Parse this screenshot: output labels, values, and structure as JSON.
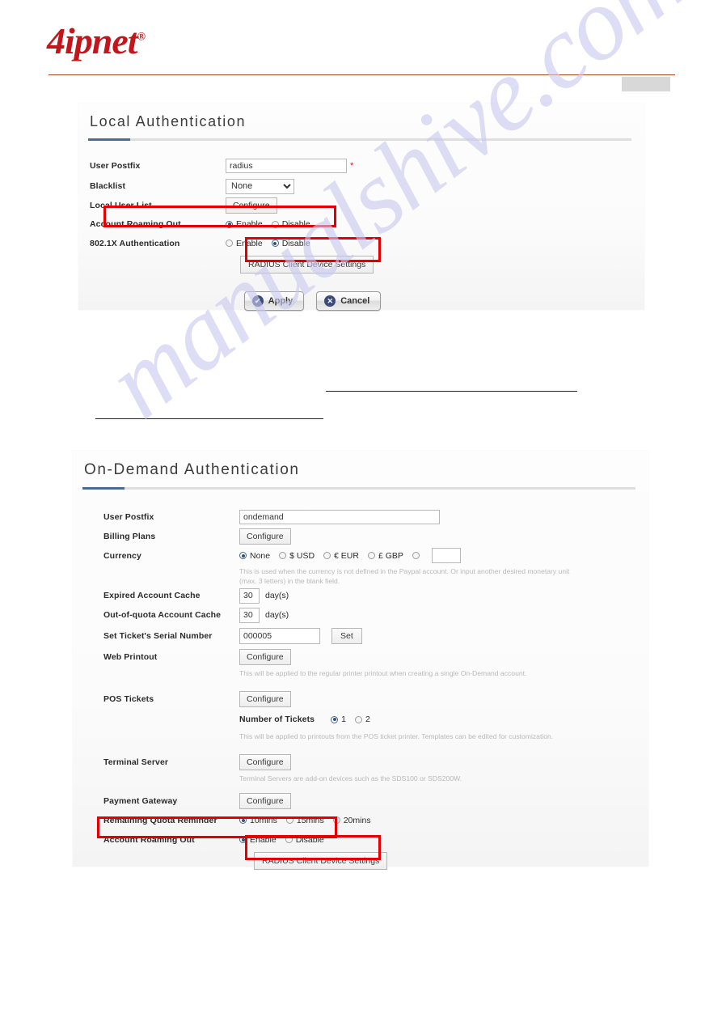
{
  "brand": {
    "name": "4ipnet",
    "reg": "®"
  },
  "local_auth": {
    "title": "Local Authentication",
    "rows": {
      "user_postfix": {
        "label": "User Postfix",
        "value": "radius",
        "required_mark": "*"
      },
      "blacklist": {
        "label": "Blacklist",
        "value": "None",
        "options": [
          "None"
        ]
      },
      "local_user_list": {
        "label": "Local User List",
        "button": "Configure"
      },
      "account_roaming_out": {
        "label": "Account Roaming Out",
        "options": [
          {
            "label": "Enable",
            "selected": true
          },
          {
            "label": "Disable",
            "selected": false
          }
        ]
      },
      "dot1x_auth": {
        "label": "802.1X Authentication",
        "options": [
          {
            "label": "Enable",
            "selected": false
          },
          {
            "label": "Disable",
            "selected": true
          }
        ]
      },
      "radius_client": {
        "button": "RADIUS Client Device Settings"
      }
    },
    "actions": {
      "apply": {
        "label": "Apply",
        "glyph": "✔"
      },
      "cancel": {
        "label": "Cancel",
        "glyph": "✕"
      }
    }
  },
  "ondemand_auth": {
    "title": "On-Demand Authentication",
    "rows": {
      "user_postfix": {
        "label": "User Postfix",
        "value": "ondemand"
      },
      "billing_plans": {
        "label": "Billing Plans",
        "button": "Configure"
      },
      "currency": {
        "label": "Currency",
        "options": [
          {
            "label": "None",
            "selected": true
          },
          {
            "label": "$ USD",
            "selected": false
          },
          {
            "label": "€ EUR",
            "selected": false
          },
          {
            "label": "£ GBP",
            "selected": false
          },
          {
            "label": "",
            "selected": false
          }
        ],
        "custom_value": "",
        "hint": "This is used when the currency is not defined in the Paypal account. Or input another desired monetary unit (max. 3 letters) in the blank field."
      },
      "expired_account_cache": {
        "label": "Expired Account Cache",
        "value": "30",
        "unit": "day(s)"
      },
      "out_of_quota_account_cache": {
        "label": "Out-of-quota Account Cache",
        "value": "30",
        "unit": "day(s)"
      },
      "ticket_serial": {
        "label": "Set Ticket's Serial Number",
        "value": "000005",
        "button": "Set"
      },
      "web_printout": {
        "label": "Web Printout",
        "button": "Configure",
        "hint": "This will be applied to the regular printer printout when creating a single On-Demand account."
      },
      "pos_tickets": {
        "label": "POS Tickets",
        "button": "Configure"
      },
      "number_of_tickets": {
        "label": "Number of Tickets",
        "options": [
          {
            "label": "1",
            "selected": true
          },
          {
            "label": "2",
            "selected": false
          }
        ],
        "hint": "This will be applied to printouts from the POS ticket printer. Templates can be edited for customization."
      },
      "terminal_server": {
        "label": "Terminal Server",
        "button": "Configure",
        "hint": "Terminal Servers are add-on devices such as the SDS100 or SDS200W."
      },
      "payment_gateway": {
        "label": "Payment Gateway",
        "button": "Configure"
      },
      "remaining_quota_reminder": {
        "label": "Remaining Quota Reminder",
        "options": [
          {
            "label": "10mins",
            "selected": true
          },
          {
            "label": "15mins",
            "selected": false
          },
          {
            "label": "20mins",
            "selected": false
          }
        ]
      },
      "account_roaming_out": {
        "label": "Account Roaming Out",
        "options": [
          {
            "label": "Enable",
            "selected": true
          },
          {
            "label": "Disable",
            "selected": false
          }
        ]
      },
      "radius_client": {
        "button": "RADIUS Client Device Settings"
      }
    }
  },
  "watermark": {
    "text": "manualshive.com"
  }
}
